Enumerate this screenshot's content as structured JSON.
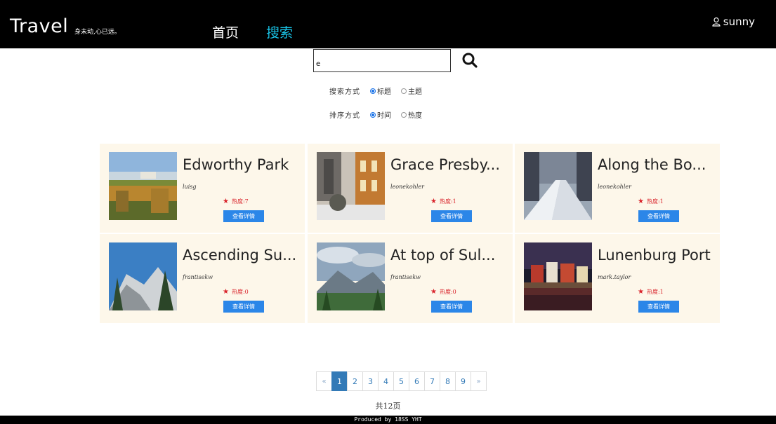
{
  "header": {
    "brand": "Travel",
    "slogan": "身未动,心已远。",
    "nav": {
      "home": "首页",
      "search": "搜索"
    },
    "user": "sunny"
  },
  "search": {
    "value": "e",
    "method_label": "搜索方式",
    "method_options": [
      "标题",
      "主题"
    ],
    "method_selected": "标题",
    "sort_label": "排序方式",
    "sort_options": [
      "时间",
      "热度"
    ],
    "sort_selected": "时间"
  },
  "cards": [
    {
      "title": "Edworthy Park",
      "author": "luisg",
      "heat_label": "热度:",
      "heat": "7",
      "button": "查看详情"
    },
    {
      "title": "Grace Presby...",
      "author": "leonekohler",
      "heat_label": "热度:",
      "heat": "1",
      "button": "查看详情"
    },
    {
      "title": "Along the Bo...",
      "author": "leonekohler",
      "heat_label": "热度:",
      "heat": "1",
      "button": "查看详情"
    },
    {
      "title": "Ascending Su...",
      "author": "frantisekw",
      "heat_label": "热度:",
      "heat": "0",
      "button": "查看详情"
    },
    {
      "title": "At top of Sul...",
      "author": "frantisekw",
      "heat_label": "热度:",
      "heat": "0",
      "button": "查看详情"
    },
    {
      "title": "Lunenburg Port",
      "author": "mark.taylor",
      "heat_label": "热度:",
      "heat": "1",
      "button": "查看详情"
    }
  ],
  "pagination": {
    "prev": "«",
    "pages": [
      "1",
      "2",
      "3",
      "4",
      "5",
      "6",
      "7",
      "8",
      "9"
    ],
    "active": "1",
    "next": "»",
    "total": "共12页"
  },
  "footer": "Produced by 18SS YHT",
  "colors": {
    "nav_active": "#19c3e6",
    "card_bg": "#fdf7ea",
    "button": "#2b86e8",
    "heat": "#d9232b",
    "page_active": "#337ab7"
  }
}
